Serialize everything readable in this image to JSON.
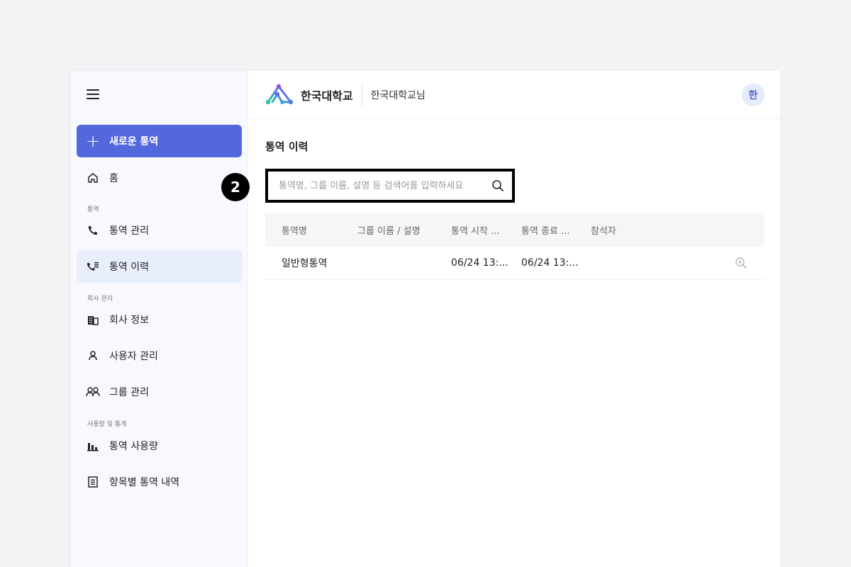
{
  "sidebar": {
    "new_button": "새로운 통역",
    "home": "홈",
    "sections": [
      {
        "label": "통역"
      },
      {
        "label": "회사 관리"
      },
      {
        "label": "사용량 및 통계"
      }
    ],
    "items": [
      {
        "label": "통역 관리",
        "icon": "phone-icon"
      },
      {
        "label": "통역 이력",
        "icon": "phone-list-icon",
        "active": true
      },
      {
        "label": "회사 정보",
        "icon": "building-icon"
      },
      {
        "label": "사용자 관리",
        "icon": "user-icon"
      },
      {
        "label": "그룹 관리",
        "icon": "group-icon"
      },
      {
        "label": "통역 사용량",
        "icon": "bar-chart-icon"
      },
      {
        "label": "항목별 통역 내역",
        "icon": "document-icon"
      }
    ]
  },
  "header": {
    "brand": "한국대학교",
    "user": "한국대학교님",
    "avatar": "한"
  },
  "page": {
    "title": "통역 이력"
  },
  "search": {
    "placeholder": "통역명, 그룹 이름, 설명 등 검색어를 입력하세요",
    "value": ""
  },
  "annotation": {
    "step": "2"
  },
  "table": {
    "headers": [
      "통역명",
      "그룹 이름 / 설명",
      "통역 시작 ...",
      "통역 종료 ...",
      "참석자"
    ],
    "rows": [
      {
        "name": "일반형통역",
        "group": "",
        "start": "06/24 13:...",
        "end": "06/24 13:...",
        "attendees": ""
      }
    ]
  },
  "colors": {
    "accent": "#5468de",
    "active_bg": "#e8eefc",
    "sidebar_bg": "#f7f9fe"
  }
}
